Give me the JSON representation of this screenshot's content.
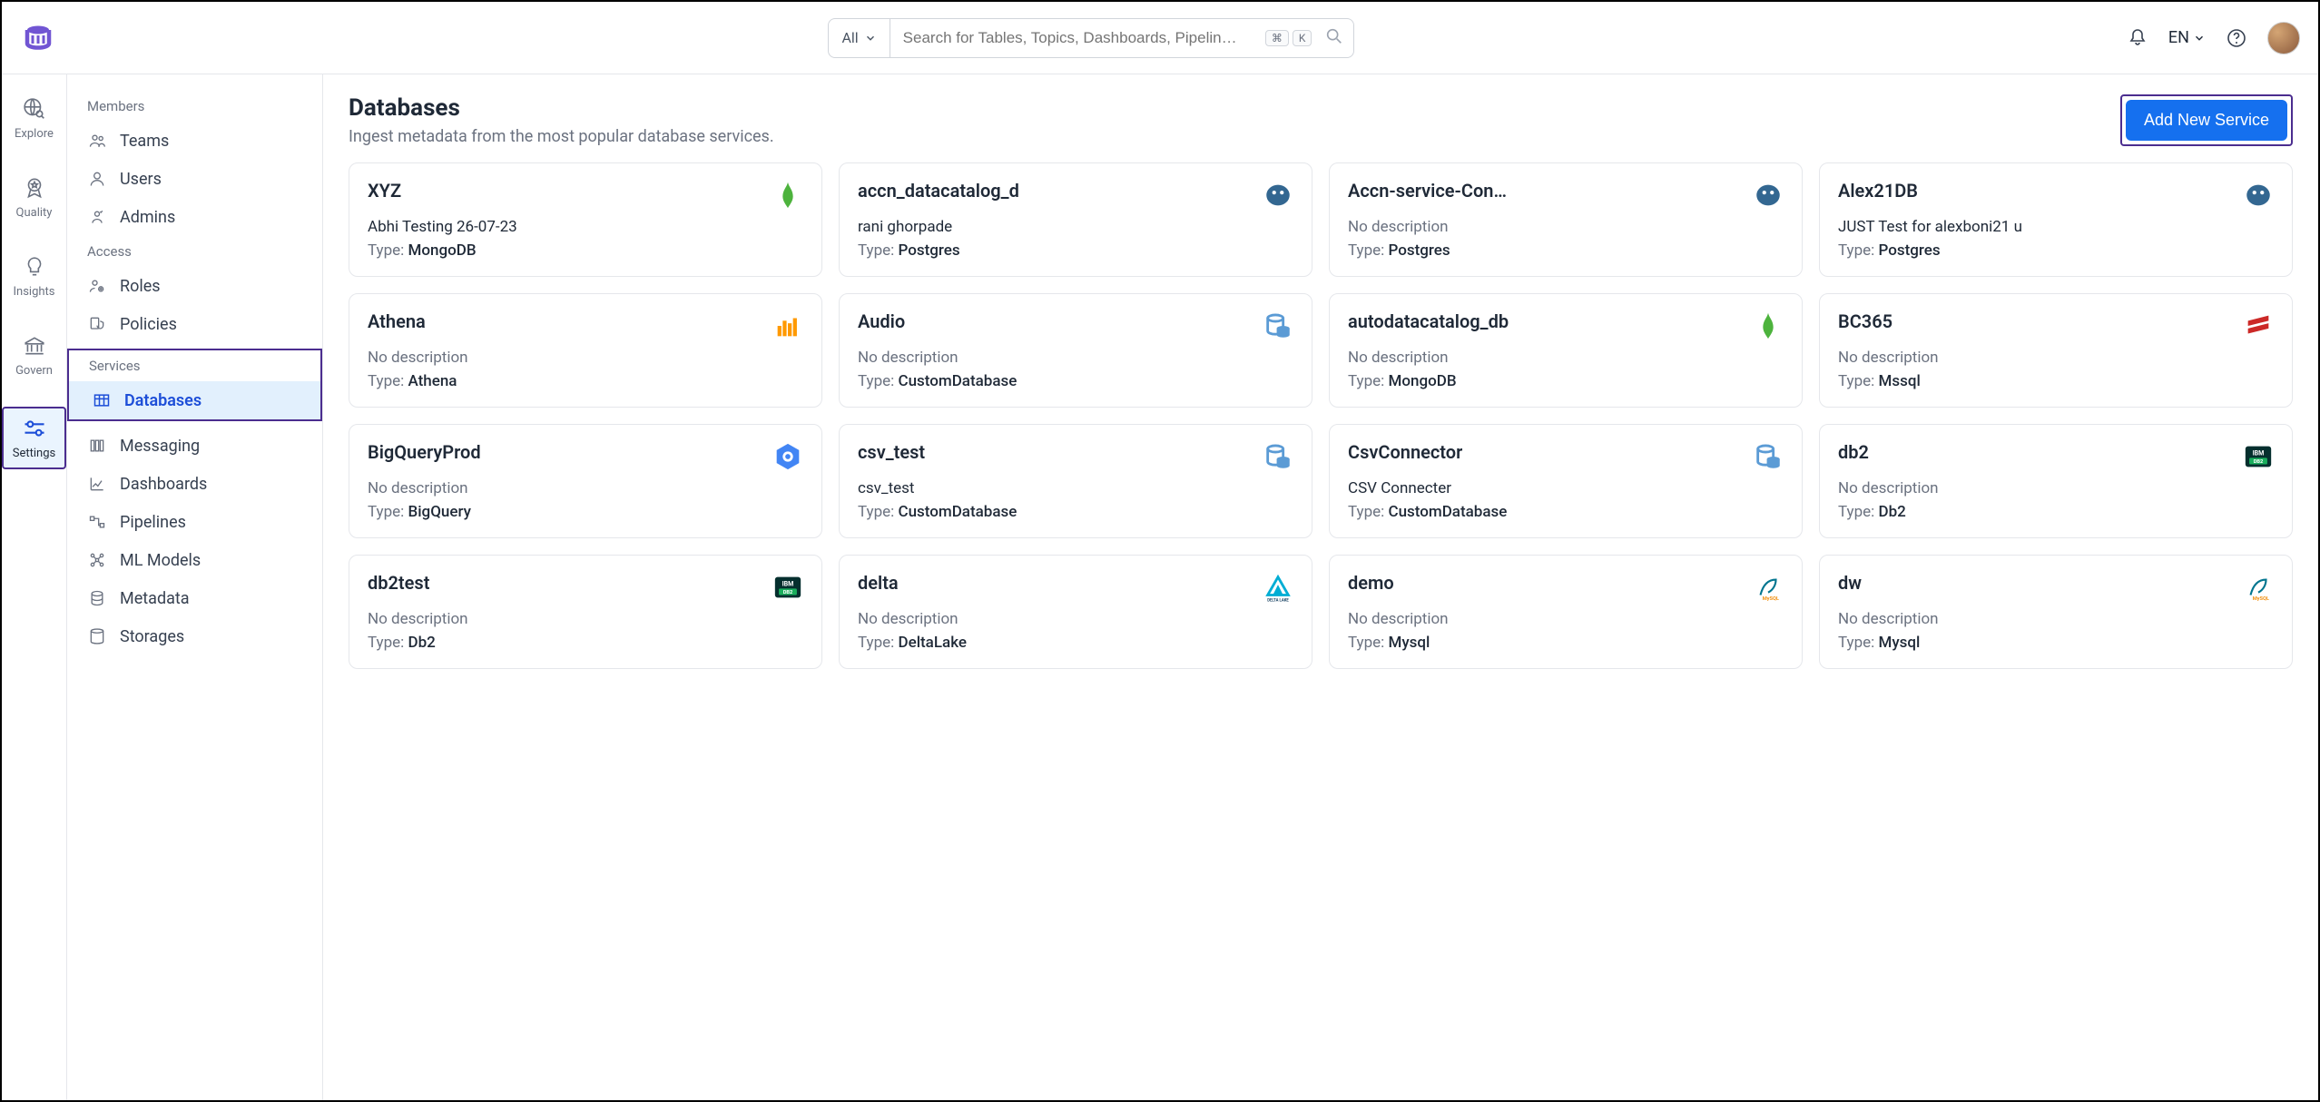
{
  "header": {
    "search_filter": "All",
    "search_placeholder": "Search for Tables, Topics, Dashboards, Pipelin…",
    "kbd1": "⌘",
    "kbd2": "K",
    "lang": "EN"
  },
  "rail": {
    "items": [
      {
        "label": "Explore"
      },
      {
        "label": "Quality"
      },
      {
        "label": "Insights"
      },
      {
        "label": "Govern"
      },
      {
        "label": "Settings"
      }
    ]
  },
  "sidebar": {
    "groups": {
      "members": {
        "title": "Members",
        "items": [
          "Teams",
          "Users",
          "Admins"
        ]
      },
      "access": {
        "title": "Access",
        "items": [
          "Roles",
          "Policies"
        ]
      },
      "services": {
        "title": "Services",
        "items": [
          "Databases",
          "Messaging",
          "Dashboards",
          "Pipelines",
          "ML Models",
          "Metadata",
          "Storages"
        ]
      }
    },
    "active": "Databases"
  },
  "page": {
    "title": "Databases",
    "subtitle": "Ingest metadata from the most popular database services.",
    "add_button": "Add New Service",
    "type_prefix": "Type: ",
    "no_description": "No description"
  },
  "cards": [
    {
      "name": "XYZ",
      "desc": "Abhi Testing 26-07-23",
      "type": "MongoDB",
      "icon": "mongodb"
    },
    {
      "name": "accn_datacatalog_d",
      "desc": "rani ghorpade",
      "type": "Postgres",
      "icon": "postgres"
    },
    {
      "name": "Accn-service-Conne",
      "desc": "",
      "type": "Postgres",
      "icon": "postgres"
    },
    {
      "name": "Alex21DB",
      "desc": "JUST Test for alexboni21 u",
      "type": "Postgres",
      "icon": "postgres"
    },
    {
      "name": "Athena",
      "desc": "",
      "type": "Athena",
      "icon": "athena"
    },
    {
      "name": "Audio",
      "desc": "",
      "type": "CustomDatabase",
      "icon": "customdb"
    },
    {
      "name": "autodatacatalog_db",
      "desc": "",
      "type": "MongoDB",
      "icon": "mongodb"
    },
    {
      "name": "BC365",
      "desc": "",
      "type": "Mssql",
      "icon": "mssql"
    },
    {
      "name": "BigQueryProd",
      "desc": "",
      "type": "BigQuery",
      "icon": "bigquery"
    },
    {
      "name": "csv_test",
      "desc": "csv_test",
      "type": "CustomDatabase",
      "icon": "customdb"
    },
    {
      "name": "CsvConnector",
      "desc": "CSV Connecter",
      "type": "CustomDatabase",
      "icon": "customdb"
    },
    {
      "name": "db2",
      "desc": "",
      "type": "Db2",
      "icon": "db2"
    },
    {
      "name": "db2test",
      "desc": "",
      "type": "Db2",
      "icon": "db2"
    },
    {
      "name": "delta",
      "desc": "",
      "type": "DeltaLake",
      "icon": "deltalake"
    },
    {
      "name": "demo",
      "desc": "",
      "type": "Mysql",
      "icon": "mysql"
    },
    {
      "name": "dw",
      "desc": "",
      "type": "Mysql",
      "icon": "mysql"
    }
  ]
}
